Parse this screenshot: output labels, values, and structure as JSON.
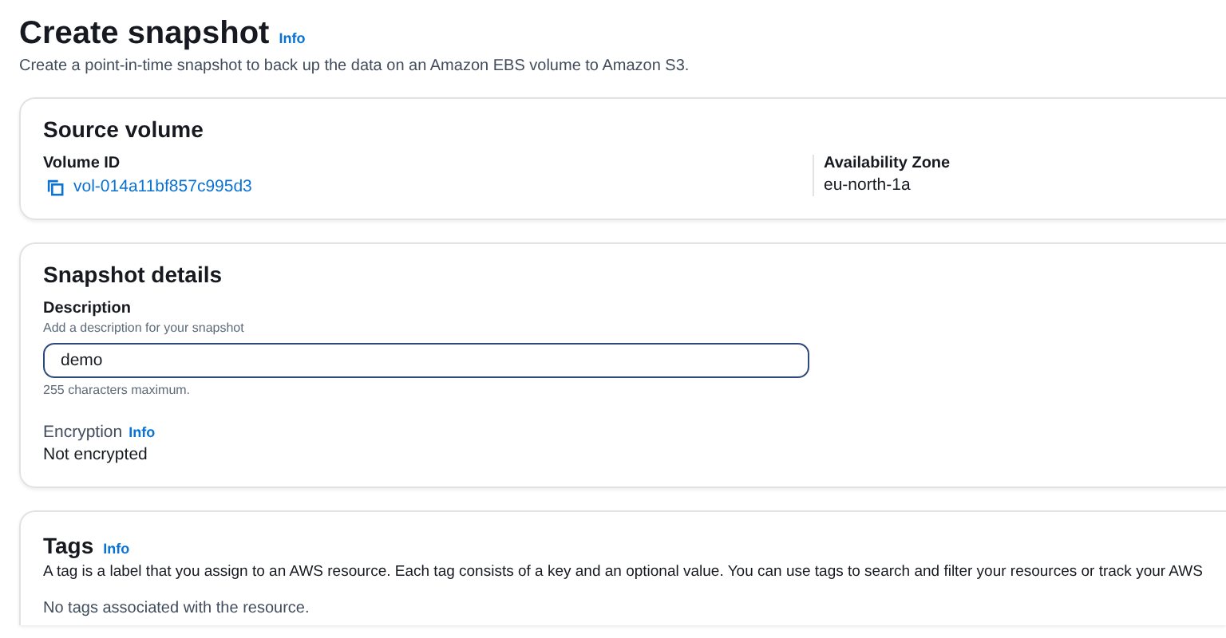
{
  "header": {
    "title": "Create snapshot",
    "info": "Info",
    "description": "Create a point-in-time snapshot to back up the data on an Amazon EBS volume to Amazon S3."
  },
  "source_volume": {
    "title": "Source volume",
    "fields": [
      {
        "label": "Volume ID",
        "value": "vol-014a11bf857c995d3",
        "kind": "copy-link"
      },
      {
        "label": "Availability Zone",
        "value": "eu-north-1a",
        "kind": "text"
      }
    ]
  },
  "snapshot_details": {
    "title": "Snapshot details",
    "description_field": {
      "label": "Description",
      "hint": "Add a description for your snapshot",
      "value": "demo",
      "constraint": "255 characters maximum."
    },
    "encryption": {
      "label": "Encryption",
      "info": "Info",
      "value": "Not encrypted"
    }
  },
  "tags": {
    "title": "Tags",
    "info": "Info",
    "description": "A tag is a label that you assign to an AWS resource. Each tag consists of a key and an optional value. You can use tags to search and filter your resources or track your AWS",
    "empty": "No tags associated with the resource."
  }
}
